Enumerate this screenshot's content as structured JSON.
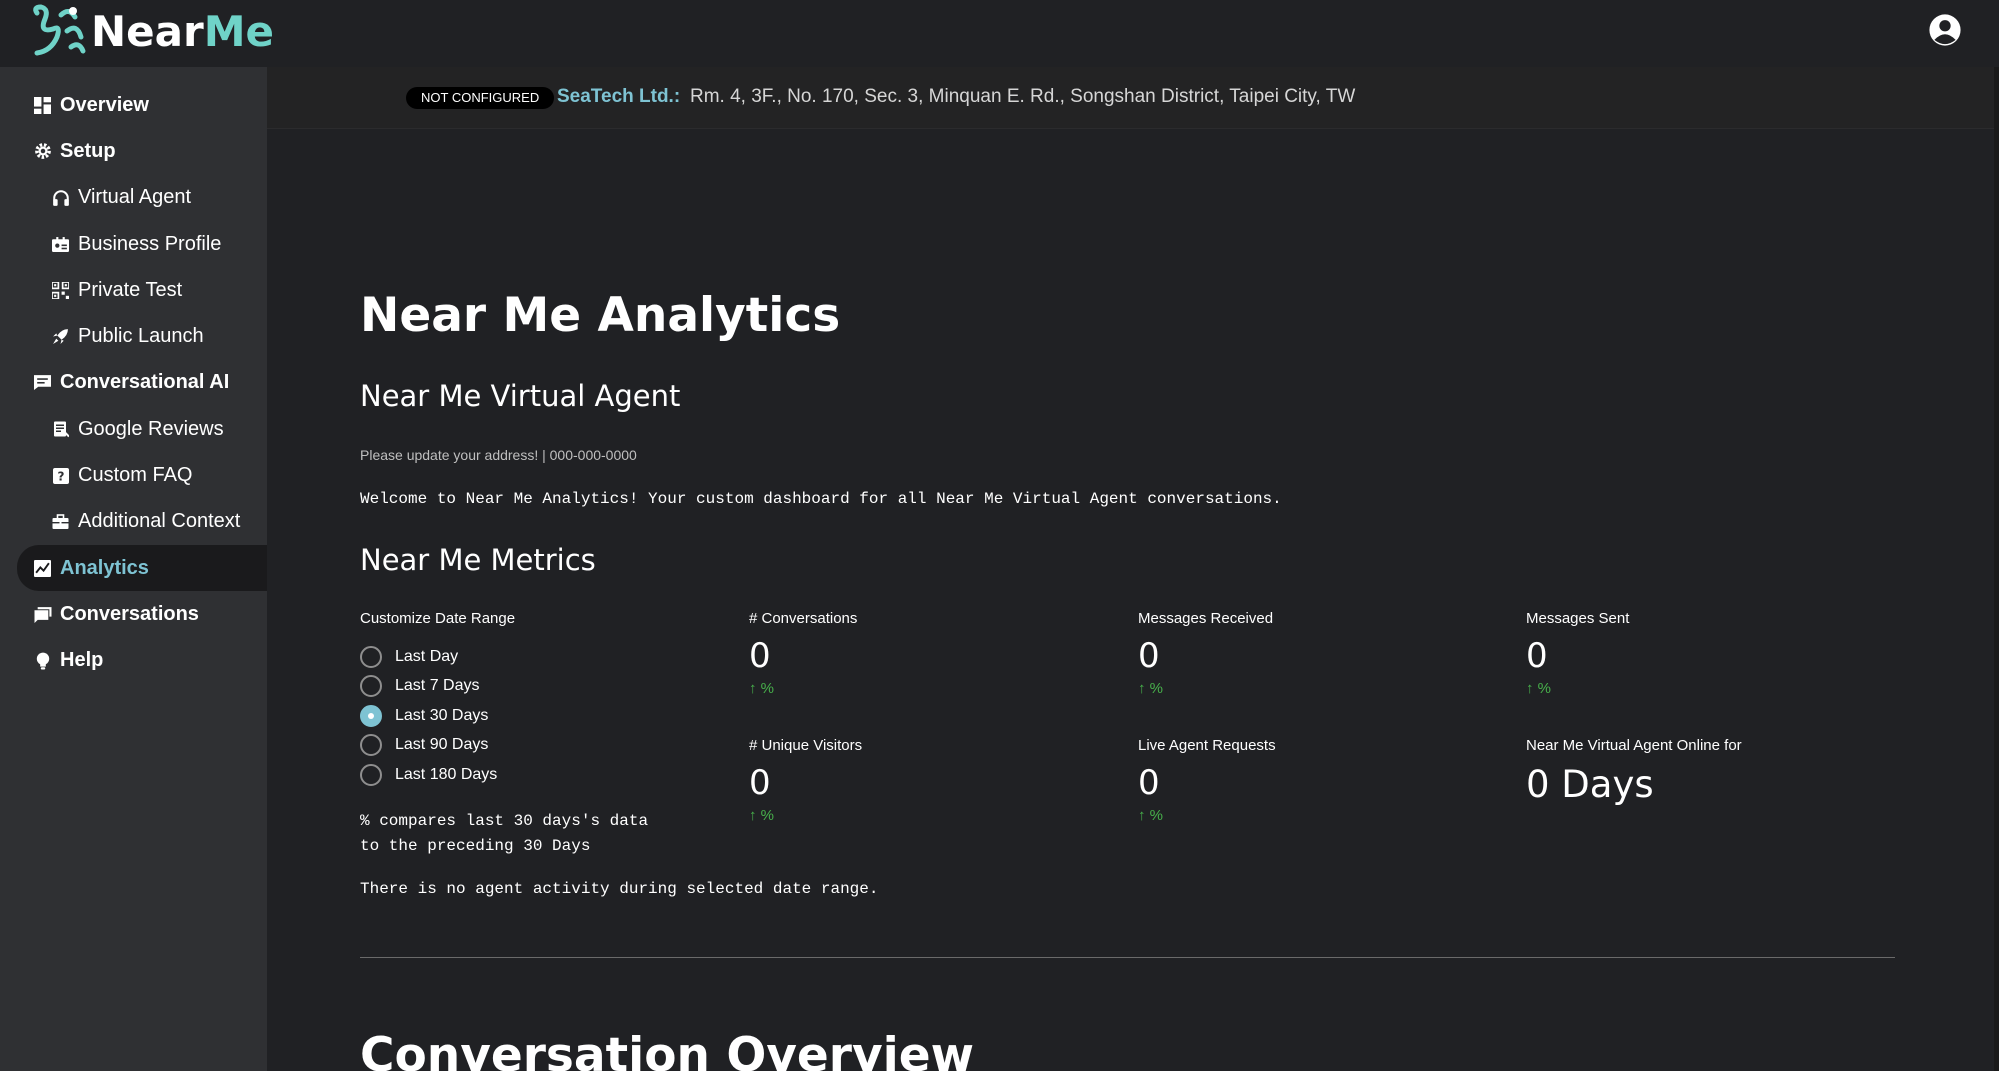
{
  "app": {
    "logo_near": "Near",
    "logo_me": "Me",
    "brand_color": "#6fd3c8",
    "accent_color": "#7ec3d3",
    "user_icon": "account-circle-icon"
  },
  "sidebar": {
    "items": [
      {
        "label": "Overview",
        "icon": "dashboard-icon",
        "level": "top"
      },
      {
        "label": "Setup",
        "icon": "gear-icon",
        "level": "top"
      },
      {
        "label": "Virtual Agent",
        "icon": "headset-icon",
        "level": "sub"
      },
      {
        "label": "Business Profile",
        "icon": "id-card-icon",
        "level": "sub"
      },
      {
        "label": "Private Test",
        "icon": "qr-code-icon",
        "level": "sub"
      },
      {
        "label": "Public Launch",
        "icon": "rocket-icon",
        "level": "sub"
      },
      {
        "label": "Conversational AI",
        "icon": "chat-icon",
        "level": "top"
      },
      {
        "label": "Google Reviews",
        "icon": "review-icon",
        "level": "sub"
      },
      {
        "label": "Custom FAQ",
        "icon": "question-icon",
        "level": "sub"
      },
      {
        "label": "Additional Context",
        "icon": "briefcase-icon",
        "level": "sub"
      },
      {
        "label": "Analytics",
        "icon": "analytics-icon",
        "level": "top",
        "active": true
      },
      {
        "label": "Conversations",
        "icon": "messages-icon",
        "level": "top"
      },
      {
        "label": "Help",
        "icon": "lightbulb-icon",
        "level": "top"
      }
    ]
  },
  "banner": {
    "badge": "NOT CONFIGURED",
    "company": "SeaTech Ltd.:",
    "address": "Rm. 4, 3F., No. 170, Sec. 3, Minquan E. Rd., Songshan District, Taipei City, TW"
  },
  "main": {
    "title": "Near Me Analytics",
    "agent_heading": "Near Me Virtual Agent",
    "agent_sub": "Please update your address! | 000-000-0000",
    "welcome": "Welcome to Near Me Analytics! Your custom dashboard for all Near Me Virtual Agent conversations.",
    "metrics_heading": "Near Me Metrics",
    "range_title": "Customize Date Range",
    "range_options": [
      {
        "label": "Last Day",
        "checked": false
      },
      {
        "label": "Last 7 Days",
        "checked": false
      },
      {
        "label": "Last 30 Days",
        "checked": true
      },
      {
        "label": "Last 90 Days",
        "checked": false
      },
      {
        "label": "Last 180 Days",
        "checked": false
      }
    ],
    "compare_line1": "% compares last 30 days's data",
    "compare_line2": "to the preceding 30 Days",
    "no_activity": "There is no agent activity during selected date range.",
    "metrics": [
      {
        "label": "# Conversations",
        "value": "0",
        "delta": "↑ %"
      },
      {
        "label": "Messages Received",
        "value": "0",
        "delta": "↑ %"
      },
      {
        "label": "Messages Sent",
        "value": "0",
        "delta": "↑ %"
      },
      {
        "label": "# Unique Visitors",
        "value": "0",
        "delta": "↑ %"
      },
      {
        "label": "Live Agent Requests",
        "value": "0",
        "delta": "↑ %"
      },
      {
        "label": "Near Me Virtual Agent Online for",
        "value": "0 Days",
        "delta": ""
      }
    ],
    "conversation_heading": "Conversation Overview"
  }
}
